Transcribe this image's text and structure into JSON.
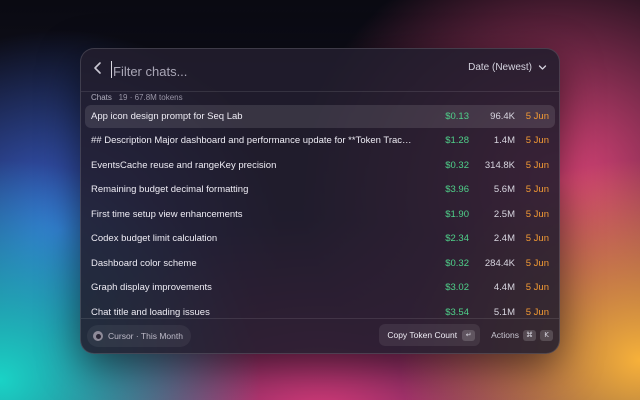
{
  "search": {
    "placeholder": "Filter chats..."
  },
  "sort": {
    "label": "Date (Newest)"
  },
  "section": {
    "title": "Chats",
    "summary": "19 · 67.8M tokens"
  },
  "chats": [
    {
      "name": "App icon design prompt for Seq Lab",
      "cost": "$0.13",
      "tokens": "96.4K",
      "date": "5 Jun"
    },
    {
      "name": "## Description Major dashboard and performance update for **Token Track** — est...",
      "cost": "$1.28",
      "tokens": "1.4M",
      "date": "5 Jun"
    },
    {
      "name": "EventsCache reuse and rangeKey precision",
      "cost": "$0.32",
      "tokens": "314.8K",
      "date": "5 Jun"
    },
    {
      "name": "Remaining budget decimal formatting",
      "cost": "$3.96",
      "tokens": "5.6M",
      "date": "5 Jun"
    },
    {
      "name": "First time setup view enhancements",
      "cost": "$1.90",
      "tokens": "2.5M",
      "date": "5 Jun"
    },
    {
      "name": "Codex budget limit calculation",
      "cost": "$2.34",
      "tokens": "2.4M",
      "date": "5 Jun"
    },
    {
      "name": "Dashboard color scheme",
      "cost": "$0.32",
      "tokens": "284.4K",
      "date": "5 Jun"
    },
    {
      "name": "Graph display improvements",
      "cost": "$3.02",
      "tokens": "4.4M",
      "date": "5 Jun"
    },
    {
      "name": "Chat title and loading issues",
      "cost": "$3.54",
      "tokens": "5.1M",
      "date": "5 Jun"
    }
  ],
  "footer": {
    "source": "Cursor · This Month",
    "primary_action": "Copy Token Count",
    "primary_key": "↵",
    "actions_label": "Actions",
    "actions_keys": [
      "⌘",
      "K"
    ]
  },
  "colors": {
    "cost": "#4fd18a",
    "date": "#f39a34"
  }
}
